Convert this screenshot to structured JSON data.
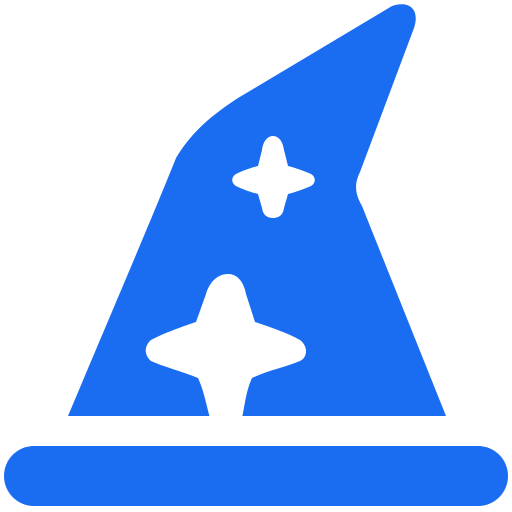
{
  "icon": {
    "name": "wizard-hat-icon",
    "color": "#1A6DF0",
    "background": "#FFFFFF"
  }
}
